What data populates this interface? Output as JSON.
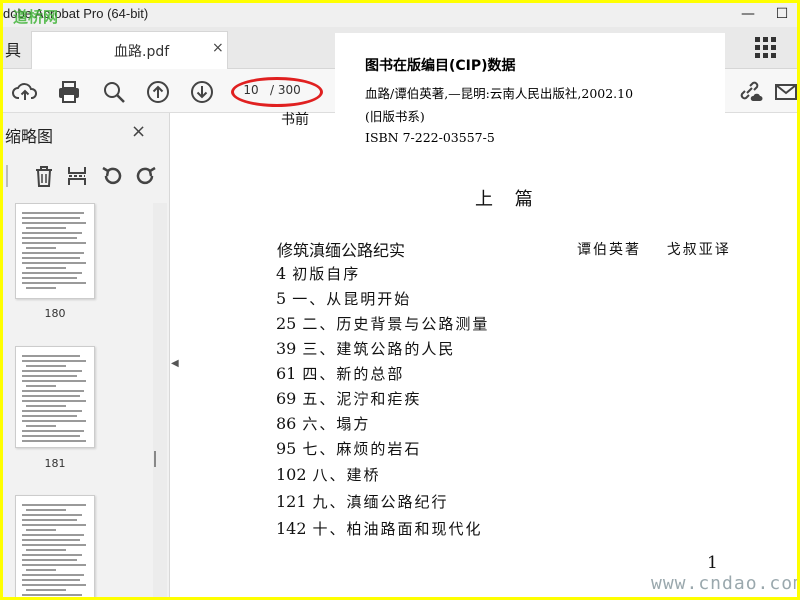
{
  "window": {
    "title": "dobe Acrobat Pro (64-bit)",
    "watermark_top": "道桥网",
    "minimize": "—",
    "maximize": "☐"
  },
  "tabs": {
    "tools_label": "具",
    "active_tab": "血路.pdf",
    "close": "×"
  },
  "toolbar": {
    "icons": [
      "upload-icon",
      "print-icon",
      "zoom-icon",
      "page-up-icon",
      "page-down-icon",
      "link-cloud-icon",
      "mail-icon"
    ],
    "current_page": "10",
    "total_pages": "/ 300",
    "annotation_color": "#e02020"
  },
  "sidebar": {
    "title": "缩略图",
    "close": "×",
    "tools": [
      "delete-icon",
      "extract-icon",
      "rotate-left-icon",
      "rotate-right-icon"
    ],
    "thumbnails": [
      {
        "label": "180"
      },
      {
        "label": "181"
      },
      {
        "label": ""
      }
    ]
  },
  "document": {
    "header_fragment": "书前",
    "section_title": "上  篇",
    "book_title": "修筑滇缅公路纪实",
    "authors": "谭伯英著    戈叔亚译",
    "toc": [
      {
        "page": "4",
        "title": "初版自序"
      },
      {
        "page": "5",
        "title": "一、从昆明开始"
      },
      {
        "page": "25",
        "title": "二、历史背景与公路测量"
      },
      {
        "page": "39",
        "title": "三、建筑公路的人民"
      },
      {
        "page": "61",
        "title": "四、新的总部"
      },
      {
        "page": "69",
        "title": "五、泥泞和疟疾"
      },
      {
        "page": "86",
        "title": "六、塌方"
      },
      {
        "page": "95",
        "title": "七、麻烦的岩石"
      },
      {
        "page": "102",
        "title": "八、建桥"
      },
      {
        "page": "121",
        "title": "九、滇缅公路纪行"
      },
      {
        "page": "142",
        "title": "十、柏油路面和现代化"
      }
    ],
    "page_number": "1",
    "watermark_bottom": "www.cndao.com"
  },
  "cip": {
    "heading": "图书在版编目(CIP)数据",
    "line1": "血路/谭伯英著,—昆明:云南人民出版社,2002.10",
    "line2": "(旧版书系)",
    "line3": "ISBN 7-222-03557-5"
  }
}
